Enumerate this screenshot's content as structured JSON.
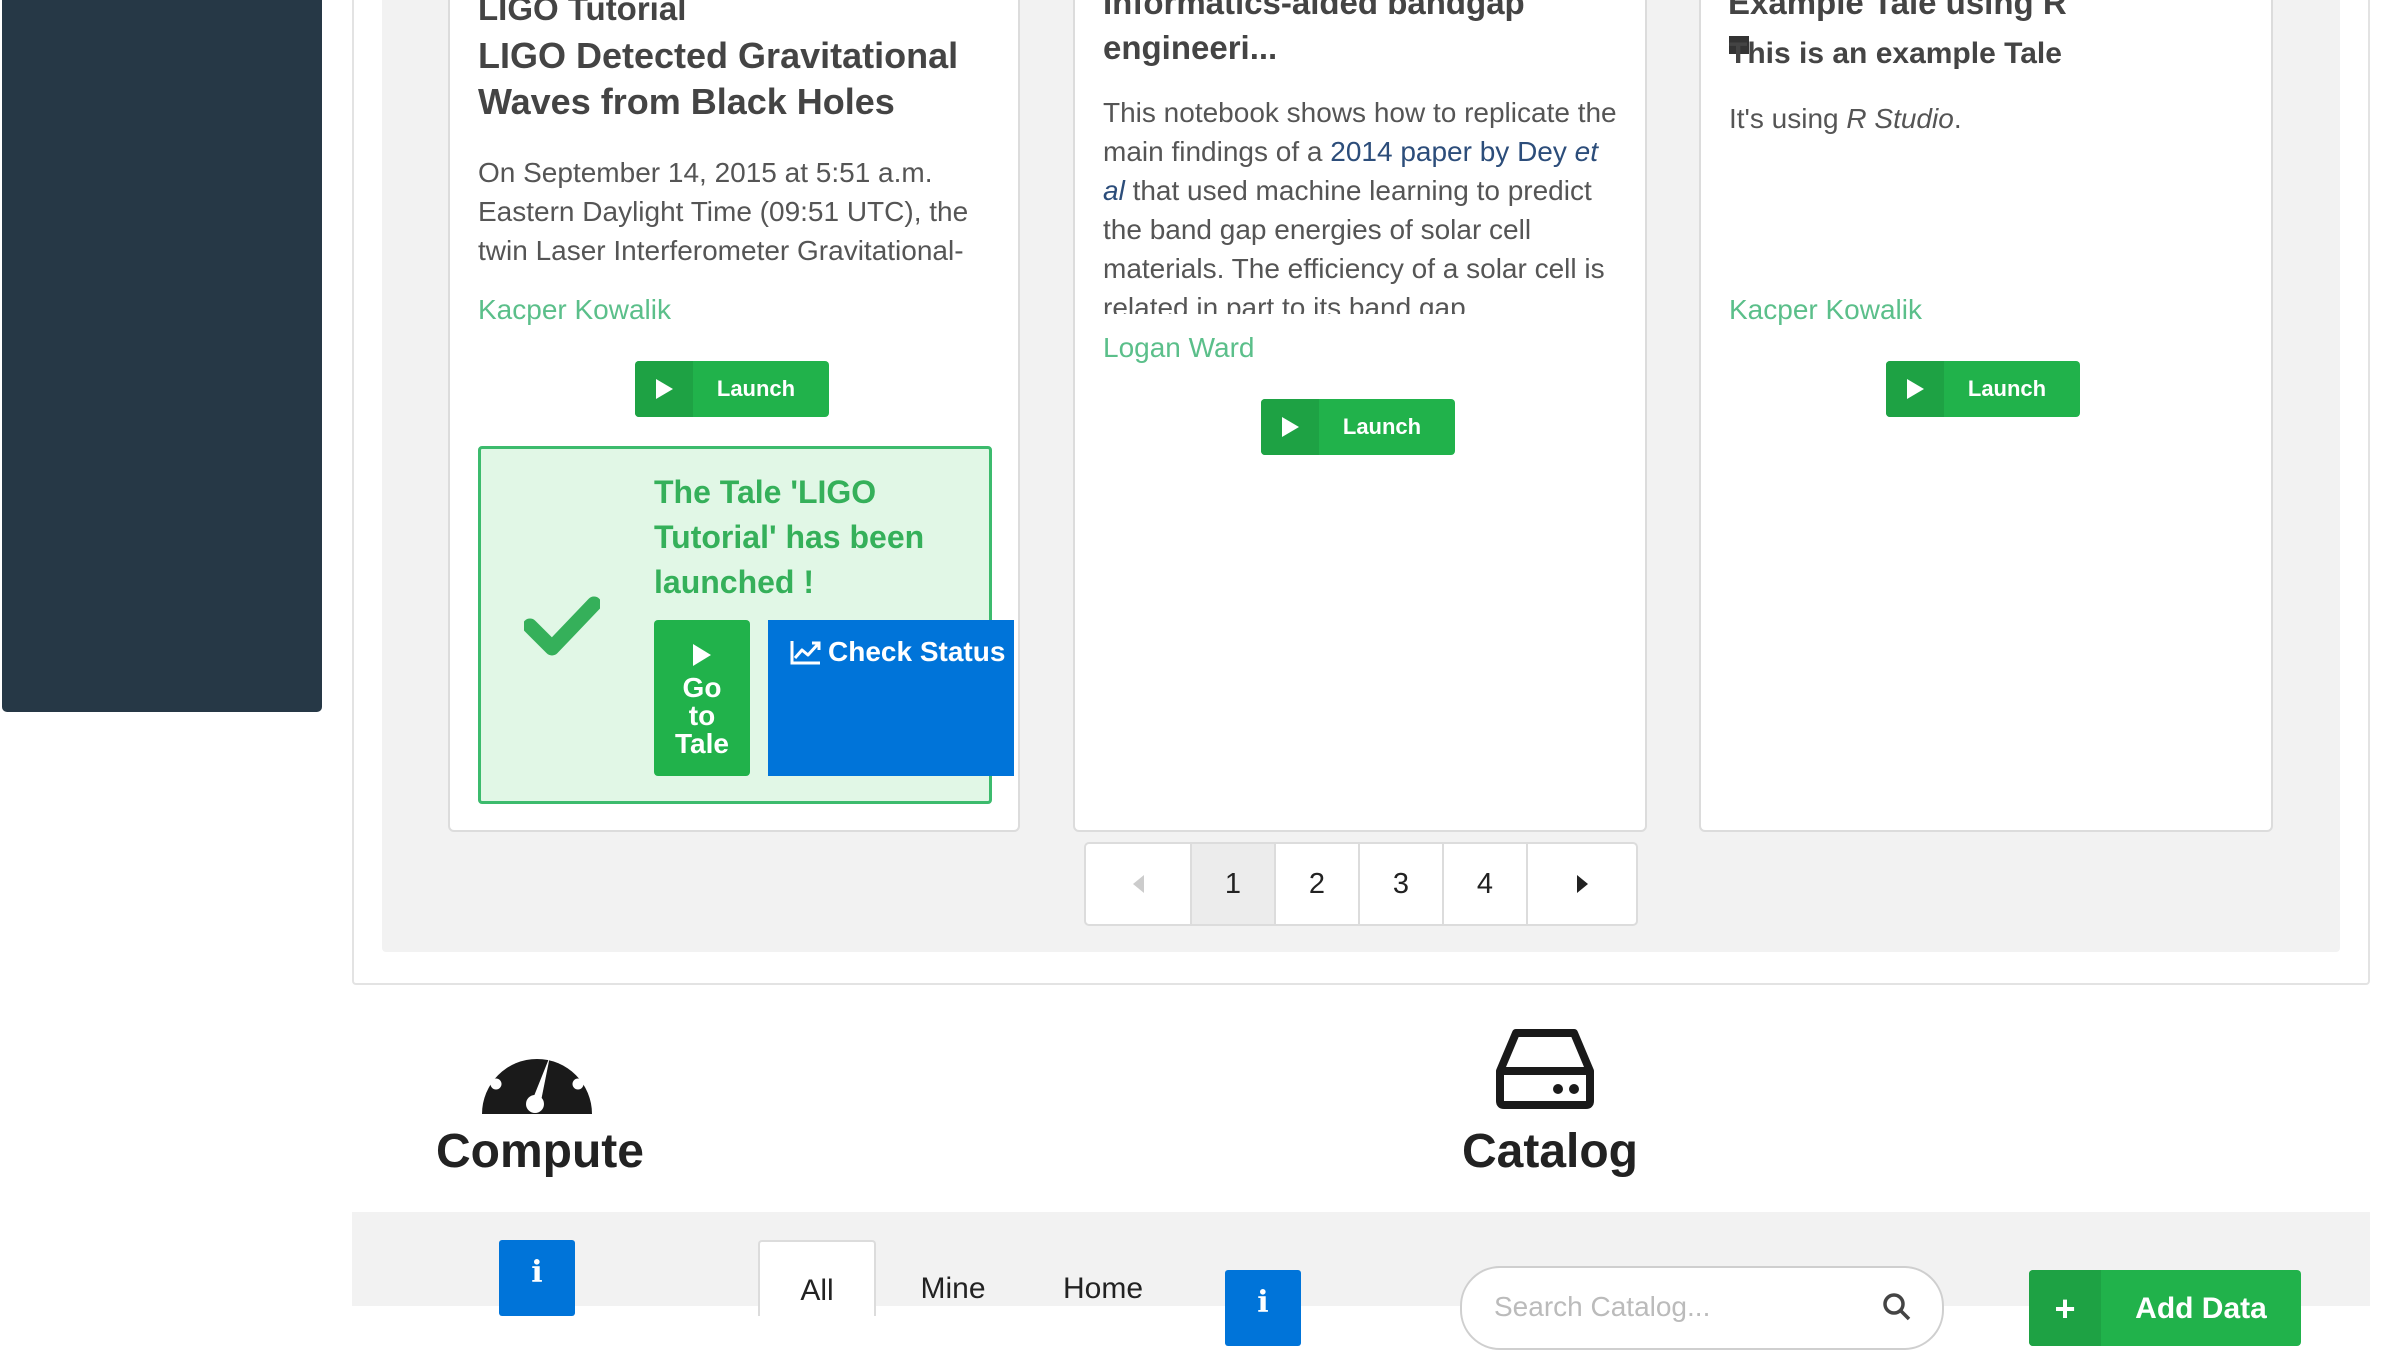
{
  "tales": [
    {
      "subtitle": "LIGO Tutorial",
      "title": "LIGO Detected Gravitational Waves from Black Holes",
      "description": "On September 14, 2015 at 5:51 a.m. Eastern Daylight Time (09:51 UTC), the twin Laser Interferometer Gravitational-",
      "author": "Kacper Kowalik",
      "launch_label": "Launch"
    },
    {
      "title_line1": "Informatics-aided bandgap",
      "title_line2": "engineeri...",
      "desc_before_link": "This notebook shows how to replicate the main findings of a ",
      "desc_link": "2014 paper by Dey ",
      "desc_link_italic": "et al",
      "desc_after_link": " that used machine learning to predict the band gap energies of solar cell materials. The efficiency of a solar cell is related in part to its band gap",
      "author": "Logan Ward",
      "launch_label": "Launch"
    },
    {
      "title": "Example Tale using R",
      "subtitle": "This is an example Tale",
      "desc_prefix": "It's using ",
      "desc_italic": "R Studio",
      "desc_suffix": ".",
      "author": "Kacper Kowalik",
      "launch_label": "Launch"
    }
  ],
  "launch_message": {
    "text": "The Tale 'LIGO Tutorial' has been launched !",
    "goto_line1": "Go",
    "goto_line2": "to",
    "goto_line3": "Tale",
    "check_status": "Check Status"
  },
  "pagination": {
    "pages": [
      "1",
      "2",
      "3",
      "4"
    ],
    "current_page": "1"
  },
  "compute": {
    "title": "Compute",
    "info_label": "i"
  },
  "catalog": {
    "title": "Catalog",
    "tabs": [
      "All",
      "Mine",
      "Home"
    ],
    "active_tab": "All",
    "info_label": "i",
    "search_placeholder": "Search Catalog...",
    "add_data_label": "Add Data"
  },
  "icons": {
    "sidebar": "sidebar-panel",
    "launch": "play-icon",
    "success": "checkmark-icon",
    "status": "chart-line-icon",
    "compute": "dashboard-gauge-icon",
    "catalog": "hard-drive-icon",
    "search": "search-icon",
    "add": "plus-icon"
  },
  "colors": {
    "sidebar": "#263846",
    "success_green": "#21b24b",
    "status_blue": "#0074d9",
    "author_green": "#5bbf8a"
  }
}
